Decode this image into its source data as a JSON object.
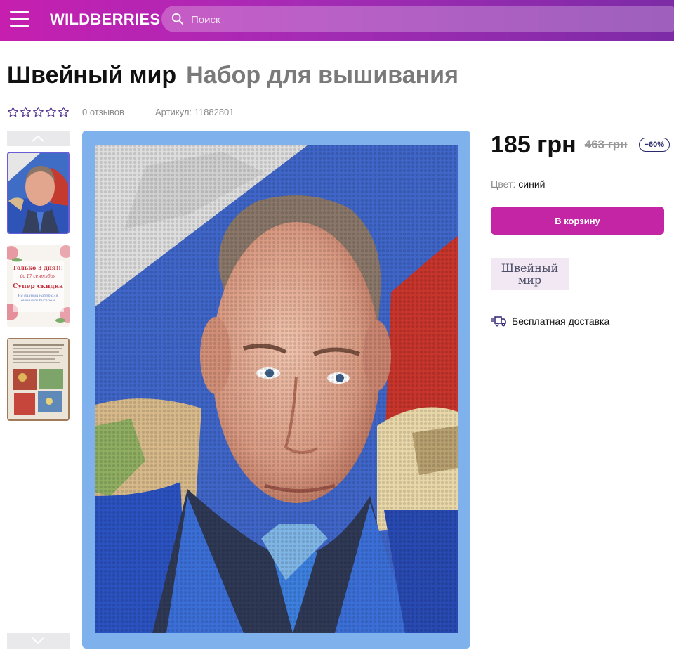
{
  "header": {
    "logo": "WILDBERRIES",
    "search_placeholder": "Поиск",
    "gradient": [
      "#c61fb0",
      "#7d2ba6"
    ]
  },
  "product": {
    "brand": "Швейный мир",
    "name": "Набор для вышивания",
    "rating": 0,
    "reviews": "0 отзывов",
    "article": "Артикул: 11882801",
    "price": "185 грн",
    "old_price": "463 грн",
    "discount": "−60%",
    "color_label": "Цвет:",
    "color_value": "синий",
    "cart_button": "В корзину",
    "brand_logo_text": "Швейный мир",
    "delivery": "Бесплатная доставка"
  },
  "thumbnails": [
    {
      "name": "portrait-thumbnail",
      "selected": true
    },
    {
      "name": "promo-thumbnail",
      "selected": false
    },
    {
      "name": "kit-contents-thumbnail",
      "selected": false
    }
  ],
  "promo_thumb_text": [
    "Только 3 дня!!!",
    "до 17 сентября",
    "Супер скидка",
    "На данный набор для",
    "вышивки бисером"
  ],
  "icons": {
    "menu": "hamburger-icon",
    "search": "search-icon",
    "star": "star-outline-icon",
    "up": "chevron-up-icon",
    "down": "chevron-down-icon",
    "delivery": "truck-icon"
  },
  "colors": {
    "accent": "#c325a5",
    "image_border": "#7fb2ec",
    "selected_thumb": "#6a5bd6"
  }
}
